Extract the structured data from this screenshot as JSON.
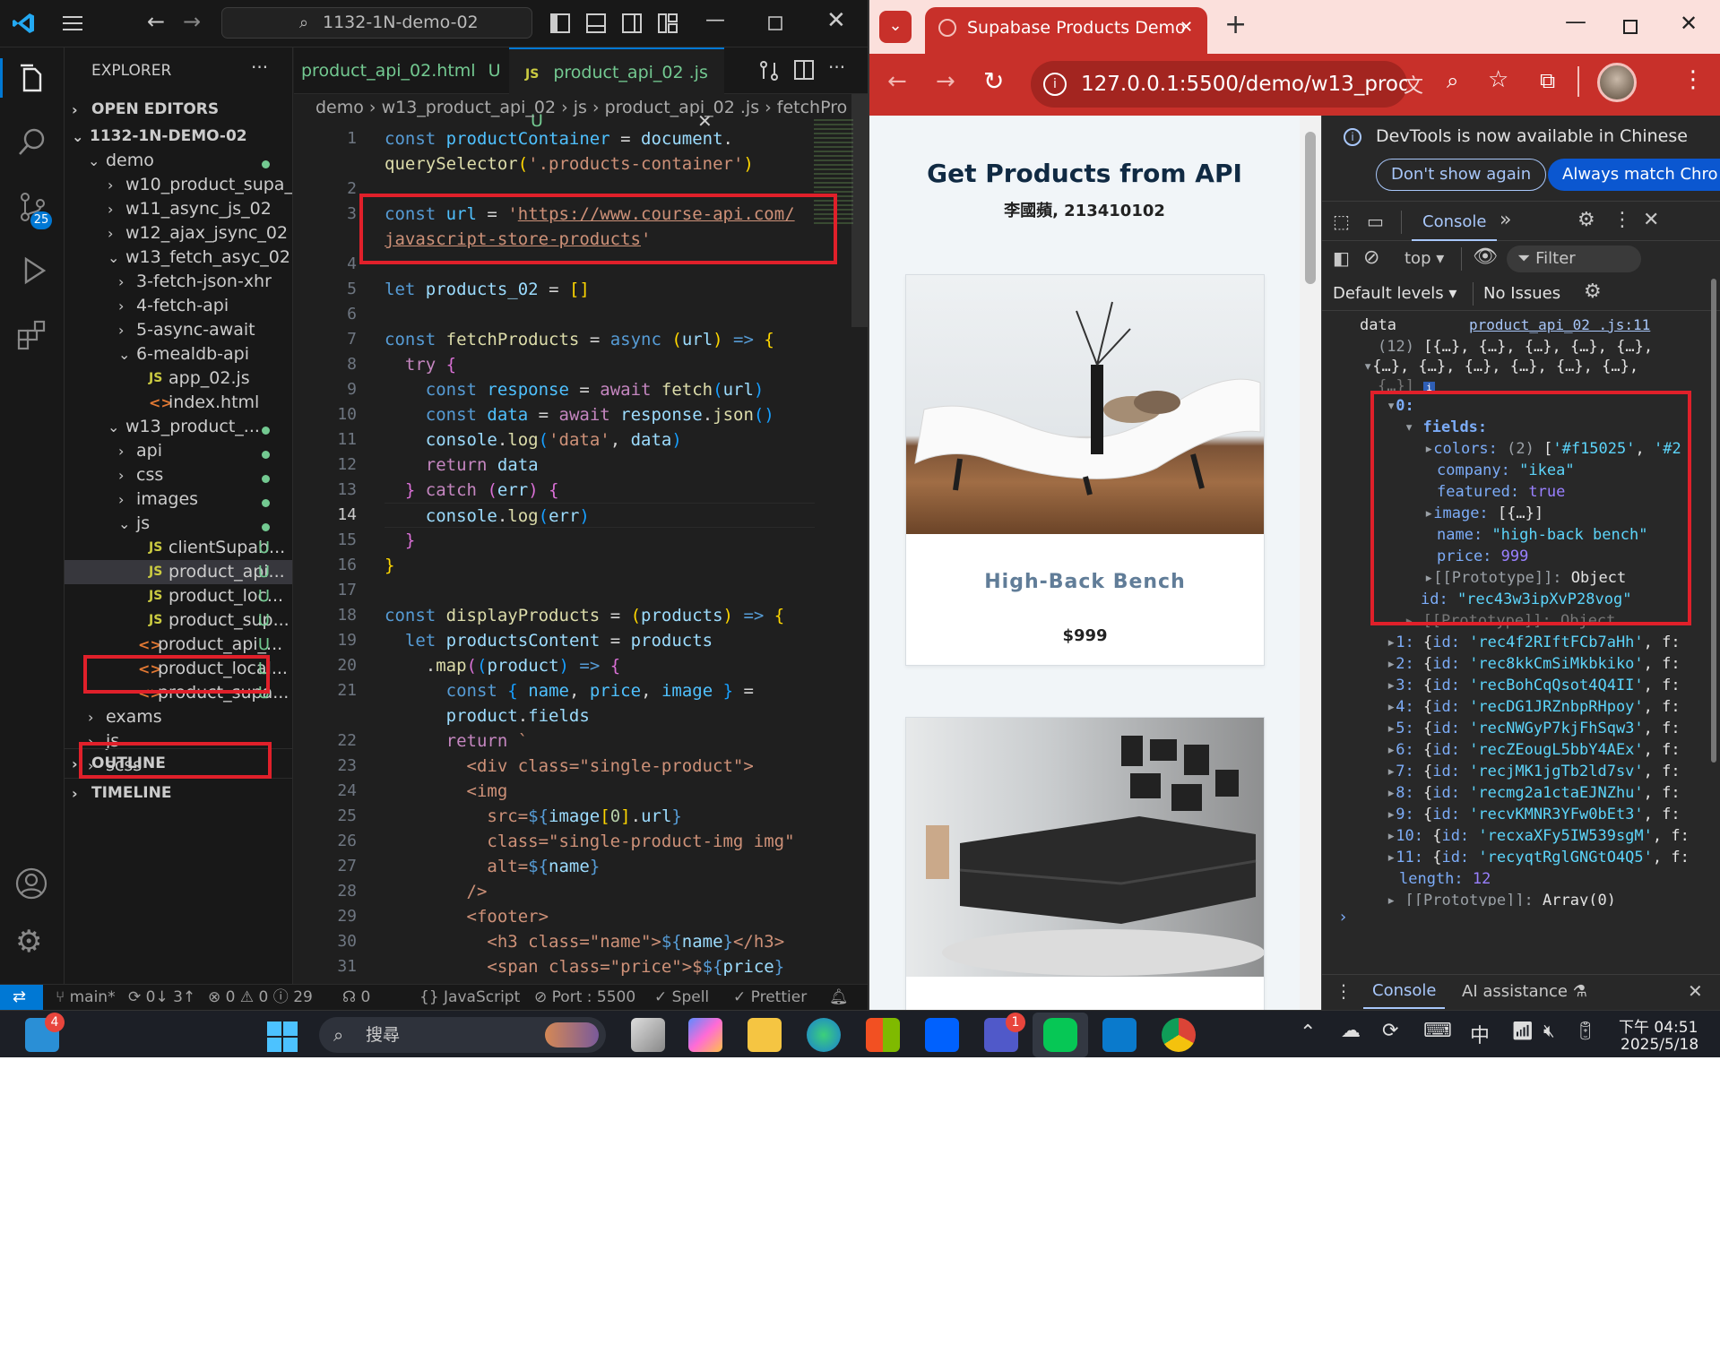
{
  "vscode": {
    "search_text": "1132-1N-demo-02",
    "explorer_title": "EXPLORER",
    "explorer_menu": "···",
    "git_badge": "25",
    "sections": {
      "open_editors": "OPEN EDITORS",
      "outline": "OUTLINE",
      "timeline": "TIMELINE"
    },
    "tree": [
      {
        "label": "1132-1N-DEMO-02",
        "indent": 0,
        "chev": "⌄",
        "bold": true
      },
      {
        "label": "demo",
        "indent": 1,
        "chev": "⌄",
        "dot": true
      },
      {
        "label": "w10_product_supa_02",
        "indent": 2,
        "chev": "›"
      },
      {
        "label": "w11_async_js_02",
        "indent": 2,
        "chev": "›"
      },
      {
        "label": "w12_ajax_jsync_02",
        "indent": 2,
        "chev": "›"
      },
      {
        "label": "w13_fetch_asyc_02",
        "indent": 2,
        "chev": "⌄"
      },
      {
        "label": "3-fetch-json-xhr",
        "indent": 3,
        "chev": "›"
      },
      {
        "label": "4-fetch-api",
        "indent": 3,
        "chev": "›"
      },
      {
        "label": "5-async-await",
        "indent": 3,
        "chev": "›"
      },
      {
        "label": "6-mealdb-api",
        "indent": 3,
        "chev": "⌄"
      },
      {
        "label": "app_02.js",
        "indent": 4,
        "icon": "js"
      },
      {
        "label": "index.html",
        "indent": 4,
        "icon": "html"
      },
      {
        "label": "w13_product_...",
        "indent": 2,
        "chev": "⌄",
        "dot": true
      },
      {
        "label": "api",
        "indent": 3,
        "chev": "›",
        "dot": true
      },
      {
        "label": "css",
        "indent": 3,
        "chev": "›",
        "dot": true
      },
      {
        "label": "images",
        "indent": 3,
        "chev": "›",
        "dot": true
      },
      {
        "label": "js",
        "indent": 3,
        "chev": "⌄",
        "dot": true
      },
      {
        "label": "clientSupab...",
        "indent": 4,
        "icon": "js",
        "badge": "U"
      },
      {
        "label": "product_api...",
        "indent": 4,
        "icon": "js",
        "badge": "U",
        "selected": true
      },
      {
        "label": "product_loc...",
        "indent": 4,
        "icon": "js",
        "badge": "U"
      },
      {
        "label": "product_sup...",
        "indent": 4,
        "icon": "js",
        "badge": "U"
      },
      {
        "label": "product_api_...",
        "indent": 3,
        "icon": "html",
        "badge": "U"
      },
      {
        "label": "product_local...",
        "indent": 3,
        "icon": "html",
        "badge": "U"
      },
      {
        "label": "product_supa...",
        "indent": 3,
        "icon": "html",
        "badge": "U"
      },
      {
        "label": "exams",
        "indent": 1,
        "chev": "›"
      },
      {
        "label": "js",
        "indent": 1,
        "chev": "›"
      },
      {
        "label": "scss",
        "indent": 1,
        "chev": "›"
      }
    ],
    "tabs": [
      {
        "label": "product_api_02.html",
        "badge": "U",
        "active": false
      },
      {
        "label": "product_api_02 .js",
        "badge": "U",
        "active": true
      }
    ],
    "breadcrumb": [
      "demo",
      "w13_product_api_02",
      "js",
      "product_api_02 .js",
      "fetchPro"
    ],
    "statusbar": {
      "branch": "main*",
      "sync": "0↓ 3↑",
      "errors": "0",
      "warnings": "0",
      "info": "29",
      "ports": "0",
      "language": "JavaScript",
      "port": "Port : 5500",
      "spell": "Spell",
      "prettier": "Prettier"
    },
    "line_numbers": [
      "1",
      "",
      "2",
      "3",
      "",
      "4",
      "5",
      "6",
      "7",
      "8",
      "9",
      "10",
      "11",
      "12",
      "13",
      "14",
      "15",
      "16",
      "17",
      "18",
      "19",
      "20",
      "21",
      "",
      "22",
      "23",
      "24",
      "25",
      "26",
      "27",
      "28",
      "29",
      "30",
      "31"
    ],
    "current_line": "14"
  },
  "chrome": {
    "tab_title": "Supabase Products Demo",
    "url": "127.0.0.1:5500/demo/w13_prod...",
    "page": {
      "title": "Get Products from API",
      "subtitle": "李國蘋, 213410102",
      "products": [
        {
          "name": "High-Back Bench",
          "price": "$999"
        }
      ]
    },
    "devtools": {
      "banner": "DevTools is now available in Chinese",
      "btn_dont_show": "Don't show again",
      "btn_match": "Always match Chro",
      "tab_console": "Console",
      "context": "top",
      "filter": "Filter",
      "levels": "Default levels",
      "issues": "No Issues",
      "log_label": "data",
      "log_link": "product_api_02 .js:11",
      "bottom_console": "Console",
      "bottom_ai": "AI assistance"
    }
  },
  "taskbar": {
    "search": "搜尋",
    "widget_badge": "4",
    "teams_badge": "1",
    "ime": "中",
    "time": "下午 04:51",
    "date": "2025/5/18"
  }
}
